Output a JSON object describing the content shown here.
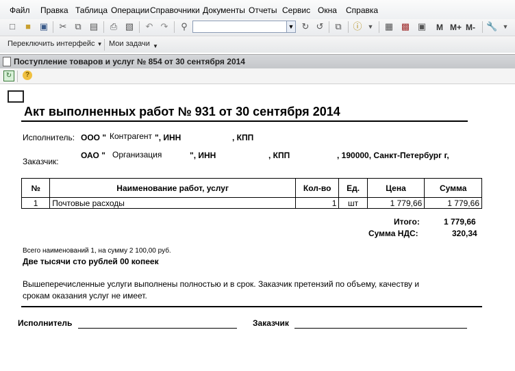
{
  "menu": [
    "Файл",
    "Правка",
    "Таблица",
    "Операции",
    "Справочники",
    "Документы",
    "Отчеты",
    "Сервис",
    "Окна",
    "Справка"
  ],
  "toolbar": {
    "m_buttons": [
      "M",
      "M+",
      "M-"
    ]
  },
  "interface_bar": {
    "switch_label": "Переключить интерфейс",
    "tasks_label": "Мои задачи"
  },
  "doc_window": {
    "title": "Поступление товаров и услуг № 854 от 30 сентября 2014"
  },
  "act": {
    "title": "Акт выполненных работ № 931 от 30 сентября 2014",
    "executor_label": "Исполнитель:",
    "executor_ooo": "ООО \"",
    "executor_name": "Контрагент",
    "executor_rest": "\", ИНН",
    "executor_kpp": ", КПП",
    "customer_label": "Заказчик:",
    "customer_oao": "ОАО \"",
    "customer_name": "Организация",
    "customer_rest": "\", ИНН",
    "customer_kpp": ", КПП",
    "customer_address": ", 190000, Санкт-Петербург г,",
    "table": {
      "headers": [
        "№",
        "Наименование работ, услуг",
        "Кол-во",
        "Ед.",
        "Цена",
        "Сумма"
      ],
      "rows": [
        [
          "1",
          "Почтовые расходы",
          "1",
          "шт",
          "1 779,66",
          "1 779,66"
        ]
      ]
    },
    "total_label": "Итого:",
    "total_value": "1 779,66",
    "vat_label": "Сумма НДС:",
    "vat_value": "320,34",
    "summary_line": "Всего наименований 1, на сумму 2 100,00 руб.",
    "amount_words": "Две тысячи сто рублей 00 копеек",
    "statement_line1": "Вышеперечисленные услуги выполнены полностью и в срок. Заказчик претензий по объему, качеству и",
    "statement_line2": "срокам оказания услуг не имеет.",
    "sign_executor": "Исполнитель",
    "sign_customer": "Заказчик"
  }
}
